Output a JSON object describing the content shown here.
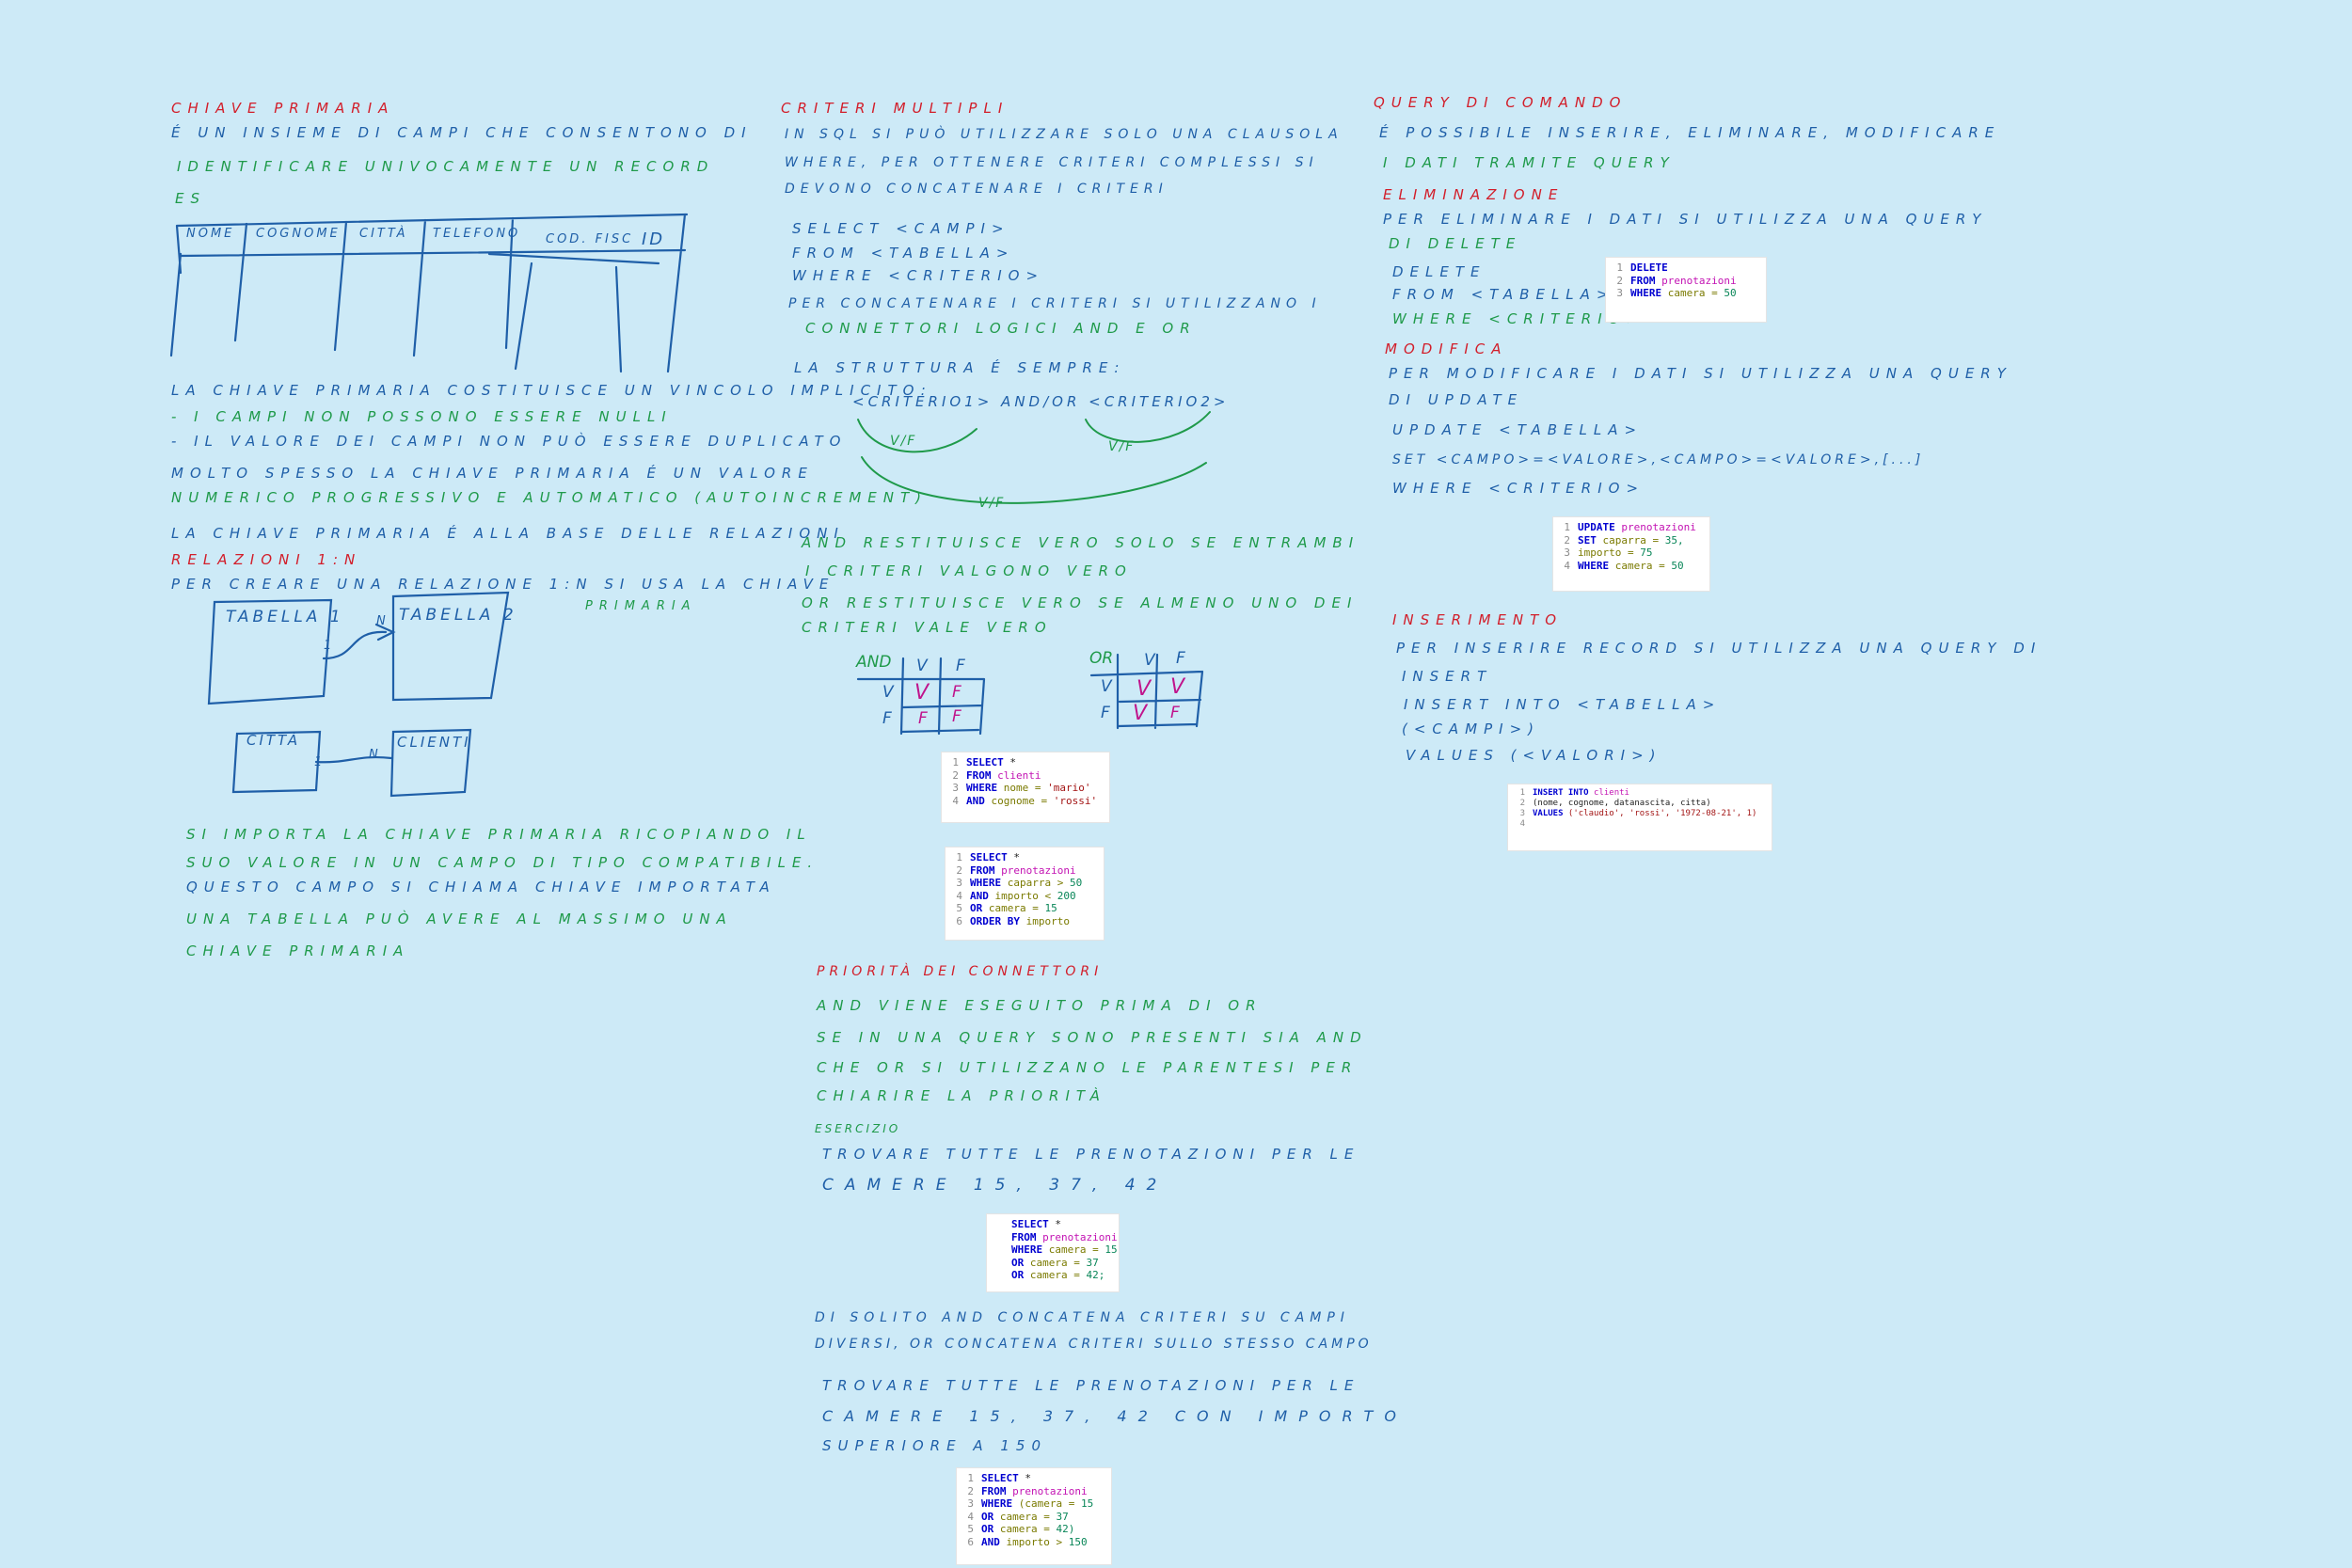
{
  "colors": {
    "background": "#cdeaf7",
    "red_ink": "#d21e2a",
    "blue_ink": "#1f5fa8",
    "green_ink": "#1f9a4a",
    "magenta_ink": "#c0148c"
  },
  "col1": {
    "title": "Chiave primaria",
    "l1": "é un insieme di campi che consentono di",
    "l2": "identificare univocamente un record",
    "es": "es",
    "table_headers": [
      "Nome",
      "Cognome",
      "Città",
      "Telefono",
      "Cod. Fisc",
      "ID"
    ],
    "v1": "La chiave primaria costituisce un vincolo implicito:",
    "v2": "- I campi non possono essere nulli",
    "v3": "- Il valore dei campi non può essere duplicato",
    "v4": "Molto spesso la chiave primaria é un valore",
    "v5": "numerico progressivo e automatico (autoincrement)",
    "v6": "La chiave primaria é alla base delle relazioni",
    "rel_title": "Relazioni 1:N",
    "rel1": "Per creare una relazione 1:N si usa la chiave",
    "rel1b": "primaria",
    "tab1": "Tabella 1",
    "tab2": "Tabella 2",
    "card_1": "1",
    "card_n": "n",
    "citta": "Città",
    "clienti": "Clienti",
    "card2_1": "1",
    "card2_n": "n",
    "i1": "Si importa la chiave primaria ricopiando il",
    "i2": "suo valore in un campo di tipo compatibile.",
    "i3": "Questo campo si chiama chiave importata",
    "i4": "Una tabella può avere al massimo una",
    "i5": "chiave primaria"
  },
  "col2": {
    "title": "Criteri multipli",
    "l1": "In SQL si può utilizzare solo una clausola",
    "l2": "Where, per ottenere criteri complessi si",
    "l3": "devono concatenare i criteri",
    "s1": "Select <campi>",
    "s2": "From <tabella>",
    "s3": "Where <criterio>",
    "p1": "Per concatenare i criteri si utilizzano i",
    "p2": "connettori logici AND e OR",
    "st": "La struttura é sempre:",
    "crit": "<criterio1> AND/OR <criterio2>",
    "vf1": "V/F",
    "vf2": "V/F",
    "vf3": "V/F",
    "a1": "AND restituisce vero solo se entrambi",
    "a2": "i criteri valgono vero",
    "o1": "OR restituisce vero se almeno uno dei",
    "o2": "criteri vale vero",
    "and_table": {
      "op": "AND",
      "hv": "V",
      "hf": "F",
      "rv": "V",
      "rf": "F",
      "c11": "V",
      "c12": "F",
      "c21": "F",
      "c22": "F"
    },
    "or_table": {
      "op": "OR",
      "hv": "V",
      "hf": "F",
      "rv": "V",
      "rf": "F",
      "c11": "V",
      "c12": "V",
      "c21": "V",
      "c22": "F"
    },
    "code1": {
      "n": [
        "1",
        "2",
        "3",
        "4"
      ],
      "l1a": "SELECT",
      "l1b": " *",
      "l2a": "FROM",
      "l2b": " clienti",
      "l3a": "WHERE",
      "l3b": " nome = ",
      "l3c": "'mario'",
      "l4a": "AND",
      "l4b": " cognome = ",
      "l4c": "'rossi'"
    },
    "code2": {
      "n": [
        "1",
        "2",
        "3",
        "4",
        "5",
        "6"
      ],
      "l1a": "SELECT",
      "l1b": " *",
      "l2a": "FROM",
      "l2b": " prenotazioni",
      "l3a": "WHERE",
      "l3b": " caparra > ",
      "l3c": "50",
      "l4a": "AND",
      "l4b": " importo < ",
      "l4c": "200",
      "l5a": "OR",
      "l5b": " camera = ",
      "l5c": "15",
      "l6a": "ORDER BY",
      "l6b": " importo"
    },
    "prio_title": "Priorità dei connettori",
    "pr1": "AND viene eseguito prima di OR",
    "pr2": "Se in una query sono presenti sia AND",
    "pr3": "che OR si utilizzano le parentesi per",
    "pr4": "chiarire la priorità",
    "es_title": "Esercizio",
    "e1": "Trovare tutte le prenotazioni per le",
    "e2": "camere 15, 37, 42",
    "code3": {
      "l1a": "SELECT",
      "l1b": " *",
      "l2a": "FROM",
      "l2b": " prenotazioni",
      "l3a": "WHERE",
      "l3b": " camera = ",
      "l3c": "15",
      "l4a": "OR",
      "l4b": " camera = ",
      "l4c": "37",
      "l5a": "OR",
      "l5b": " camera = ",
      "l5c": "42;"
    },
    "d1": "Di solito AND concatena criteri su campi",
    "d2": "diversi, OR concatena criteri sullo stesso campo",
    "f1": "Trovare tutte le prenotazioni per le",
    "f2": "camere 15, 37, 42 con importo",
    "f3": "superiore a 150",
    "code4": {
      "n": [
        "1",
        "2",
        "3",
        "4",
        "5",
        "6"
      ],
      "l1a": "SELECT",
      "l1b": " *",
      "l2a": "FROM",
      "l2b": " prenotazioni",
      "l3a": "WHERE",
      "l3b": " (camera = ",
      "l3c": "15",
      "l4a": "OR",
      "l4b": " camera = ",
      "l4c": "37",
      "l5a": "OR",
      "l5b": " camera = ",
      "l5c": "42)",
      "l6a": "AND",
      "l6b": " importo > ",
      "l6c": "150"
    }
  },
  "col3": {
    "title": "Query di comando",
    "l1": "é possibile inserire, eliminare, modificare",
    "l2": "i dati tramite query",
    "del_title": "Eliminazione",
    "dl1": "Per eliminare i dati si utilizza una query",
    "dl2": "di delete",
    "ds1": "Delete",
    "ds2": "From <tabella>",
    "ds3": "Where <criterio>",
    "code_del": {
      "n": [
        "1",
        "2",
        "3"
      ],
      "l1a": "DELETE",
      "l2a": "FROM",
      "l2b": " prenotazioni",
      "l3a": "WHERE",
      "l3b": " camera = ",
      "l3c": "50"
    },
    "mod_title": "Modifica",
    "ml1": "Per modificare i dati si utilizza una query",
    "ml2": "di update",
    "ms1": "Update <tabella>",
    "ms2": "Set <campo>=<valore>,<campo>=<valore>,[...]",
    "ms3": "Where <criterio>",
    "code_upd": {
      "n": [
        "1",
        "2",
        "3",
        "4"
      ],
      "l1a": "UPDATE",
      "l1b": " prenotazioni",
      "l2a": "SET",
      "l2b": " caparra = ",
      "l2c": "35,",
      "l3b": "importo = ",
      "l3c": "75",
      "l4a": "WHERE",
      "l4b": " camera = ",
      "l4c": "50"
    },
    "ins_title": "Inserimento",
    "il1": "Per inserire record si utilizza una query di",
    "il2": "insert",
    "is1": "Insert into <tabella>",
    "is2": "(<campi>)",
    "is3": "Values (<valori>)",
    "code_ins": {
      "n": [
        "1",
        "2",
        "3",
        "4"
      ],
      "l1a": "INSERT INTO",
      "l1b": " clienti",
      "l2": "(nome, cognome, datanascita, citta)",
      "l3a": "VALUES",
      "l3b": " ('claudio', 'rossi', '1972-08-21', 1)"
    }
  }
}
